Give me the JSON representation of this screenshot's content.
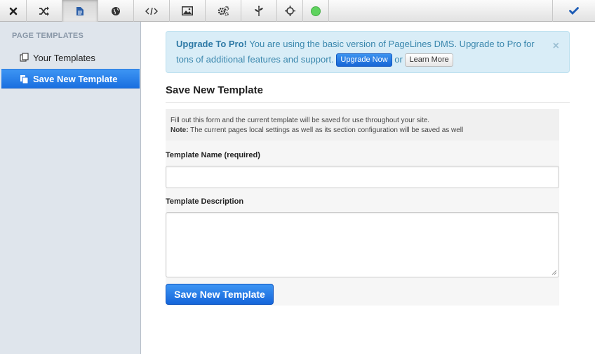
{
  "toolbar": {
    "items": [
      {
        "name": "close-icon"
      },
      {
        "name": "shuffle-icon"
      },
      {
        "name": "document-icon",
        "active": true
      },
      {
        "name": "globe-icon"
      },
      {
        "name": "code-icon"
      },
      {
        "name": "image-icon"
      },
      {
        "name": "gears-icon"
      },
      {
        "name": "plant-icon"
      },
      {
        "name": "move-icon"
      },
      {
        "name": "status-dot-icon",
        "color": "#5fd35f"
      },
      {
        "name": "checkmark-icon"
      }
    ]
  },
  "sidebar": {
    "heading": "PAGE TEMPLATES",
    "items": [
      {
        "label": "Your Templates",
        "icon": "templates-icon",
        "active": false
      },
      {
        "label": "Save New Template",
        "icon": "save-template-icon",
        "active": true
      }
    ]
  },
  "alert": {
    "title": "Upgrade To Pro!",
    "message": "You are using the basic version of PageLines DMS. Upgrade to Pro for tons of additional features and support.",
    "upgrade_button": "Upgrade Now",
    "or_text": "or",
    "learn_button": "Learn More",
    "close": "×"
  },
  "main": {
    "title": "Save New Template",
    "help_line1": "Fill out this form and the current template will be saved for use throughout your site.",
    "help_note_label": "Note:",
    "help_note_text": "The current pages local settings as well as its section configuration will be saved as well",
    "name_label": "Template Name (required)",
    "name_value": "",
    "desc_label": "Template Description",
    "desc_value": "",
    "save_button": "Save New Template"
  },
  "colors": {
    "accent": "#1a6fe0",
    "alert_bg": "#d9edf7",
    "alert_text": "#3a87ad",
    "sidebar_bg": "#dfe5ec"
  }
}
